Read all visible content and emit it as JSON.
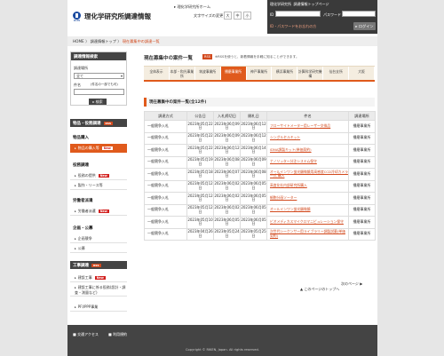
{
  "header": {
    "logo_text": "RIKEN",
    "title": "理化学研究所調達情報",
    "home_link": "理化学研究所ホーム",
    "font_label": "文字サイズの変更",
    "font_sizes": [
      "大",
      "中",
      "小"
    ]
  },
  "login": {
    "link1": "理化学研究所",
    "link2": "調達情報トップページ",
    "id_label": "ID",
    "pw_label": "パスワード",
    "help_link": "ID・パスワードをお忘れの方",
    "button": "ログイン"
  },
  "breadcrumb": {
    "home": "HOME",
    "sep1": "〉",
    "top": "調達情報トップ",
    "sep2": "〉",
    "current": "現在募集中の調達一覧"
  },
  "search": {
    "title": "調達情報検索",
    "place_label": "調達場所",
    "place_value": "全て",
    "name_label": "件名",
    "name_hint": "(件名の一部でも可)",
    "button": "検索"
  },
  "sidebar": {
    "section1": {
      "title": "物品・役務調達",
      "rss": "RSS"
    },
    "sub1": "物品購入",
    "items1": [
      {
        "label": "物品の購入等",
        "badge": "New"
      }
    ],
    "sub2": "役務調達",
    "items2": [
      {
        "label": "役務の提供",
        "badge": "New"
      },
      {
        "label": "製作・リース等",
        "badge": ""
      }
    ],
    "sub3": "労働者派遣",
    "items3": [
      {
        "label": "労働者派遣",
        "badge": "New"
      }
    ],
    "sub4": "企画・公募",
    "items4": [
      {
        "label": "企画競争",
        "badge": ""
      },
      {
        "label": "公募",
        "badge": ""
      }
    ],
    "section2": {
      "title": "工事調達",
      "rss": "RSS"
    },
    "items5": [
      {
        "label": "建設工事",
        "badge": "New"
      },
      {
        "label": "建設工事に係る役務(設計・調査・測量など)",
        "badge": ""
      },
      {
        "label": "PFI/PPP事業",
        "badge": ""
      }
    ]
  },
  "main": {
    "title": "現在募集中の案件一覧",
    "rss": "RSS",
    "rss_note": "※RSSを使うと、新着情報を手軽に知ることができます。",
    "tabs": [
      "全体表示",
      "本部・和光事業所",
      "筑波事業所",
      "播磨事業所",
      "神戸事業所",
      "横浜事業所",
      "計算科学研究機構",
      "仙台支所",
      "大阪"
    ],
    "active_tab": 3,
    "list_title": "現在募集中の案件一覧(全12件)",
    "columns": [
      "調達方式",
      "公告日",
      "入札締切日",
      "開札日",
      "件名",
      "調達場所"
    ],
    "rows": [
      [
        "一般競争入札",
        "2023年05月22日",
        "2023年06月09日",
        "2023年06月12日",
        "フローサイトメーター用レーザー交換品",
        "播磨事業所"
      ],
      [
        "一般競争入札",
        "2023年05月22日",
        "2023年06月09日",
        "2023年06月12日",
        "シングルセルキット",
        "播磨事業所"
      ],
      [
        "一般競争入札",
        "2023年05月22日",
        "2023年06月12日",
        "2023年06月14日",
        "iDNA調製キット(単価契約)",
        "播磨事業所"
      ],
      [
        "一般競争入札",
        "2023年05月19日",
        "2023年06月08日",
        "2023年06月09日",
        "ナノリッター分注システム保守",
        "播磨事業所"
      ],
      [
        "一般競争入札",
        "2023年05月18日",
        "2023年06月07日",
        "2023年06月08日",
        "オールインワン蛍光顕微鏡用高感度CCD冷却カメラ一式 購入",
        "播磨事業所"
      ],
      [
        "一般競争入札",
        "2023年05月12日",
        "2023年06月02日",
        "2023年06月05日",
        "高度化社内部研究所購入",
        "播磨事業所"
      ],
      [
        "一般競争入札",
        "2023年05月12日",
        "2023年06月02日",
        "2023年06月05日",
        "細胞分画ソーター",
        "播磨事業所"
      ],
      [
        "一般競争入札",
        "2023年05月12日",
        "2023年06月02日",
        "2023年06月05日",
        "オールインワン蛍光顕微鏡",
        "播磨事業所"
      ],
      [
        "一般競争入札",
        "2023年05月10日",
        "2023年06月05日",
        "2023年06月05日",
        "ビオメディカスマイクロマニピュレーション保守",
        "播磨事業所"
      ],
      [
        "一般競争入札",
        "2023年04月26日",
        "2023年05月24日",
        "2023年05月25日",
        "次世代シーケンサー用ライブラリー調製試薬(単価契約)",
        "播磨事業所"
      ]
    ],
    "next_link": "次のページ ▶",
    "back_top": "▲ このページのトップへ"
  },
  "footer": {
    "link1": "交通アクセス",
    "link2": "利用規約",
    "copyright": "Copyright © RIKEN, Japan. All rights reserved."
  }
}
